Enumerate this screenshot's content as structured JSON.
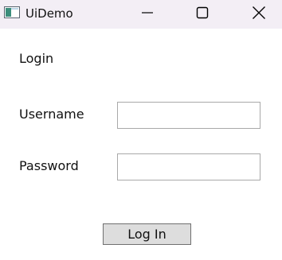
{
  "window": {
    "title": "UiDemo",
    "icon": "app-window-icon",
    "controls": {
      "minimize_icon": "minimize-icon",
      "maximize_icon": "maximize-icon",
      "close_icon": "close-icon"
    }
  },
  "form": {
    "title": "Login",
    "username": {
      "label": "Username",
      "value": ""
    },
    "password": {
      "label": "Password",
      "value": ""
    },
    "submit_label": "Log In"
  },
  "colors": {
    "titlebar_background": "#f3eef5",
    "window_background": "#ffffff",
    "input_border": "#a9a9a9",
    "button_background": "#dddddd",
    "button_border": "#707070",
    "text": "#111111"
  }
}
